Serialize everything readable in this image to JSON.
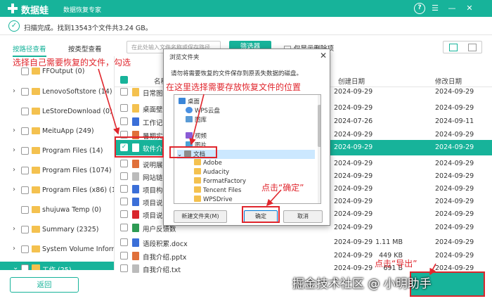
{
  "app": {
    "name": "数据蛙",
    "subtitle": "数据恢复专家",
    "help_icon": "question-icon",
    "brand_color": "#17b39a"
  },
  "status": {
    "text": "扫描完成。找到13543个文件共3.24 GB。"
  },
  "tabs": [
    {
      "label": "按路径查看",
      "active": true
    },
    {
      "label": "按类型查看",
      "active": false
    }
  ],
  "sidebar": {
    "items": [
      {
        "label": "FFOutput (0)"
      },
      {
        "label": "LenovoSoftstore (14)"
      },
      {
        "label": "LeStoreDownload (0)"
      },
      {
        "label": "MeituApp (249)"
      },
      {
        "label": "Program Files (14)"
      },
      {
        "label": "Program Files (1074)"
      },
      {
        "label": "Program Files (x86) (1976"
      },
      {
        "label": "shujuwa Temp (0)"
      },
      {
        "label": "Summary (2325)"
      },
      {
        "label": "System Volume Informati"
      },
      {
        "label": "工作 (25)"
      }
    ]
  },
  "toolbar": {
    "search_placeholder": "在此处输入文件名称或保存路径",
    "filter_label": "筛选器",
    "only_deleted_label": "仅显示删除项"
  },
  "table": {
    "headers": {
      "name": "名称",
      "create": "创建日期",
      "modified": "修改日期"
    },
    "rows": [
      {
        "name": "日常图库",
        "size": "",
        "created": "2024-09-29",
        "modified": "2024-09-29"
      },
      {
        "name": "桌面壁纸",
        "size": "",
        "created": "2024-09-29",
        "modified": "2024-09-29"
      },
      {
        "name": "工作记录1.",
        "size": "",
        "created": "2024-07-26",
        "modified": "2024-09-11"
      },
      {
        "name": "暑期实用.ppt",
        "size": "",
        "created": "2024-09-29",
        "modified": "2024-09-29"
      },
      {
        "name": "软件介绍.",
        "size": "",
        "created": "2024-09-29",
        "modified": "2024-09-29"
      },
      {
        "name": "说明展示.p",
        "size": "",
        "created": "2024-09-29",
        "modified": "2024-09-29"
      },
      {
        "name": "网站链接.t",
        "size": "",
        "created": "2024-09-29",
        "modified": "2024-09-29"
      },
      {
        "name": "项目构思.d",
        "size": "",
        "created": "2024-09-29",
        "modified": "2024-09-29"
      },
      {
        "name": "项目说明书",
        "size": "",
        "created": "2024-09-29",
        "modified": "2024-09-29"
      },
      {
        "name": "项目说明书",
        "size": "",
        "created": "2024-09-29",
        "modified": "2024-09-29"
      },
      {
        "name": "用户反馈数",
        "size": "",
        "created": "2024-09-29",
        "modified": "2024-09-29"
      },
      {
        "name": "语段积累.docx",
        "size": "1.11 MB",
        "created": "2024-09-29",
        "modified": "2024-09-29"
      },
      {
        "name": "自我介绍.pptx",
        "size": "449 KB",
        "created": "2024-09-29",
        "modified": "2024-09-29"
      },
      {
        "name": "自我介绍.txt",
        "size": "691 B",
        "created": "2024-09-29",
        "modified": "2024-09-29"
      }
    ]
  },
  "footer": {
    "back_label": "返回"
  },
  "dialog": {
    "title": "浏览文件夹",
    "message": "请勿将需要恢复的文件保存到原丢失数据的磁盘。",
    "tree": [
      {
        "label": "桌面",
        "icon": "desktop-folder-icon"
      },
      {
        "label": "WPS云盘",
        "icon": "cloud-icon"
      },
      {
        "label": "图库",
        "icon": "gallery-icon"
      },
      {
        "label": "视频",
        "icon": "video-icon"
      },
      {
        "label": "图片",
        "icon": "picture-icon"
      },
      {
        "label": "文档",
        "icon": "document-folder-icon"
      },
      {
        "label": "Adobe",
        "icon": "folder-icon"
      },
      {
        "label": "Audacity",
        "icon": "folder-icon"
      },
      {
        "label": "FormatFactory",
        "icon": "folder-icon"
      },
      {
        "label": "Tencent Files",
        "icon": "folder-icon"
      },
      {
        "label": "WPSDrive",
        "icon": "folder-icon"
      }
    ],
    "new_folder_label": "新建文件夹(M)",
    "ok_label": "确定",
    "cancel_label": "取消"
  },
  "annotations": {
    "select_files": "选择自己需要恢复的文件，勾选",
    "choose_location": "在这里选择需要存放恢复文件的位置",
    "click_ok": "点击“确定”",
    "click_export": "点击“导出”",
    "accent_red": "#e0262d"
  },
  "watermark": "掘金技术社区 @ 小明助手"
}
